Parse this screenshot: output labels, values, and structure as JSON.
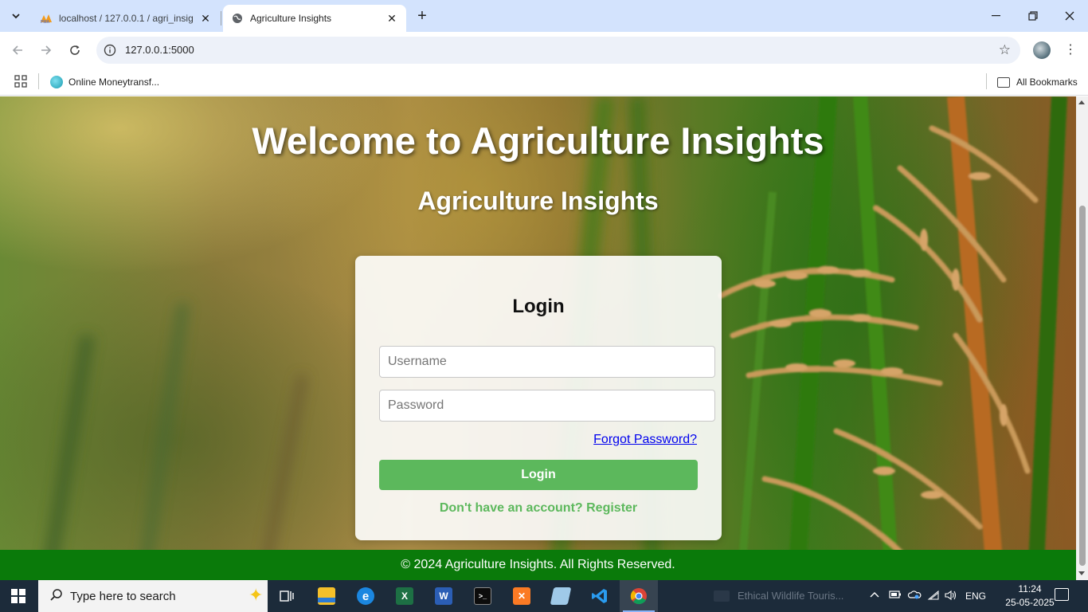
{
  "browser": {
    "tabs": [
      {
        "title": "localhost / 127.0.0.1 / agri_insig",
        "favicon": "phpmyadmin-icon",
        "active": false
      },
      {
        "title": "Agriculture Insights",
        "favicon": "globe-icon",
        "active": true
      }
    ],
    "url": "127.0.0.1:5000",
    "bookmarks": [
      {
        "label": "Online Moneytransf..."
      }
    ],
    "all_bookmarks_label": "All Bookmarks"
  },
  "page": {
    "welcome_heading": "Welcome to Agriculture Insights",
    "brand_heading": "Agriculture Insights",
    "login": {
      "title": "Login",
      "username_placeholder": "Username",
      "password_placeholder": "Password",
      "forgot_link": "Forgot Password?",
      "submit_label": "Login",
      "register_link": "Don't have an account? Register"
    },
    "footer": "© 2024 Agriculture Insights. All Rights Reserved."
  },
  "taskbar": {
    "search_placeholder": "Type here to search",
    "media_title": "Ethical Wildlife Touris...",
    "language": "ENG",
    "time": "11:24",
    "date": "25-05-2025",
    "apps": [
      "task-view-icon",
      "file-explorer-icon",
      "edge-icon",
      "excel-icon",
      "word-icon",
      "terminal-icon",
      "xampp-icon",
      "notepad-icon",
      "vscode-icon",
      "chrome-icon"
    ]
  },
  "colors": {
    "accent_green": "#5cb85c",
    "footer_green": "#0a7a0a",
    "tabstrip": "#d3e3fd",
    "taskbar": "#1c2b3a"
  }
}
